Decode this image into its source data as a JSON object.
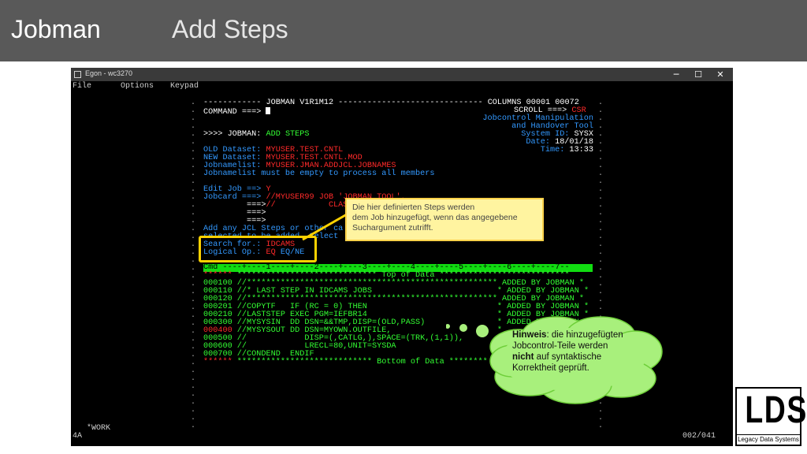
{
  "slide": {
    "title": "Jobman",
    "subtitle": "Add Steps"
  },
  "window": {
    "title": "Egon - wc3270",
    "menu": [
      "File",
      "Options",
      "Keypad"
    ],
    "minimize": "─",
    "maximize": "☐",
    "close": "✕"
  },
  "terminal": {
    "header_line": "------------ JOBMAN V1R1M12 ------------------------------ COLUMNS 00001 00072",
    "command_label": "COMMAND ===> ",
    "scroll_label": "SCROLL ===> ",
    "scroll_value": "CSR",
    "tool_line1": "Jobcontrol Manipulation",
    "tool_line2": "and Handover Tool",
    "system_label": "System ID: ",
    "system_value": "SYSX",
    "date_label": "Date: ",
    "date_value": "18/01/18",
    "time_label": "Time: ",
    "time_value": "13:33",
    "func_prefix": ">>>> JOBMAN: ",
    "func_value": "ADD STEPS",
    "old_label": "OLD Dataset: ",
    "old_value": "MYUSER.TEST.CNTL",
    "new_label": "NEW Dataset: ",
    "new_value": "MYUSER.TEST.CNTL.MOD",
    "jnl_label": "Jobnamelist: ",
    "jnl_value": "MYUSER.JMAN.ADDJCL.JOBNAMES",
    "jnl_note": "Jobnamelist must be empty to process all members",
    "edit_label": "Edit Job ==> ",
    "edit_value": "Y",
    "jobcard_label": "Jobcard ===> ",
    "jobcard1": "//MYUSER99 JOB 'JOBMAN TOOL',",
    "jobcard2": "//           CLASS",
    "arrow": "===>",
    "add_line1": "Add any JCL Steps or other ca",
    "add_line2": "selected to be added. Select",
    "search_label": "Search for.: ",
    "search_value": "IDCAMS",
    "logop_label": "Logical Op.: ",
    "logop_value": "EQ",
    "logop_opts": " EQ/NE",
    "ruler_cmd": "Cmd ",
    "ruler": "----+----1----+----2----+----3----+----4----+----5----+----6----+----7--",
    "top_marker": "******",
    "top_line": " ***************************** Top of Data ***************************",
    "data_lines": [
      {
        "num": "000100",
        "text": " //**************************************************** ADDED BY JOBMAN *",
        "numcolor": "g"
      },
      {
        "num": "000110",
        "text": " //* LAST STEP IN IDCAMS JOBS                          * ADDED BY JOBMAN *",
        "numcolor": "g"
      },
      {
        "num": "000120",
        "text": " //**************************************************** ADDED BY JOBMAN *",
        "numcolor": "g"
      },
      {
        "num": "000201",
        "text": " //COPYTF   IF (RC = 0) THEN                           * ADDED BY JOBMAN *",
        "numcolor": "g"
      },
      {
        "num": "000210",
        "text": " //LASTSTEP EXEC PGM=IEFBR14                           * ADDED BY JOBMAN *",
        "numcolor": "g"
      },
      {
        "num": "000300",
        "text": " //MYSYSIN  DD DSN=&&TMP,DISP=(OLD,PASS)               * ADDED BY JOBMAN *",
        "numcolor": "g"
      },
      {
        "num": "000400",
        "text": " //MYSYSOUT DD DSN=MYOWN.OUTFILE,                      *",
        "numcolor": "r"
      },
      {
        "num": "000500",
        "text": " //            DISP=(,CATLG,),SPACE=(TRK,(1,1)),        *",
        "numcolor": "g"
      },
      {
        "num": "000600",
        "text": " //            LRECL=80,UNIT=SYSDA",
        "numcolor": "g"
      },
      {
        "num": "000700",
        "text": " //CONDEND  ENDIF",
        "numcolor": "g"
      }
    ],
    "bottom_marker": "******",
    "bottom_line": " **************************** Bottom of Data ********"
  },
  "status": {
    "left": "4A",
    "workspace": "*WORK",
    "right": "002/041"
  },
  "callout": {
    "line1": "Die hier definierten Steps werden",
    "line2": "dem Job hinzugefügt, wenn das angegebene",
    "line3": "Suchargument zutrifft."
  },
  "bubble": {
    "bold1": "Hinweis",
    "text1": ": die hinzugefügten",
    "line2": "Jobcontrol-Teile werden",
    "bold3": "nicht",
    "text3": " auf syntaktische",
    "line4": "Korrektheit geprüft."
  },
  "logo": {
    "letters": "LDS",
    "tagline": "Legacy Data Systems"
  },
  "colors": {
    "header": "#595959",
    "terminal_green": "#33ff33",
    "terminal_blue": "#3399ff",
    "terminal_red": "#ff2a2a",
    "highlight": "#ffd200",
    "callout_bg": "#fff4a0",
    "bubble_bg": "#a8f07c"
  }
}
